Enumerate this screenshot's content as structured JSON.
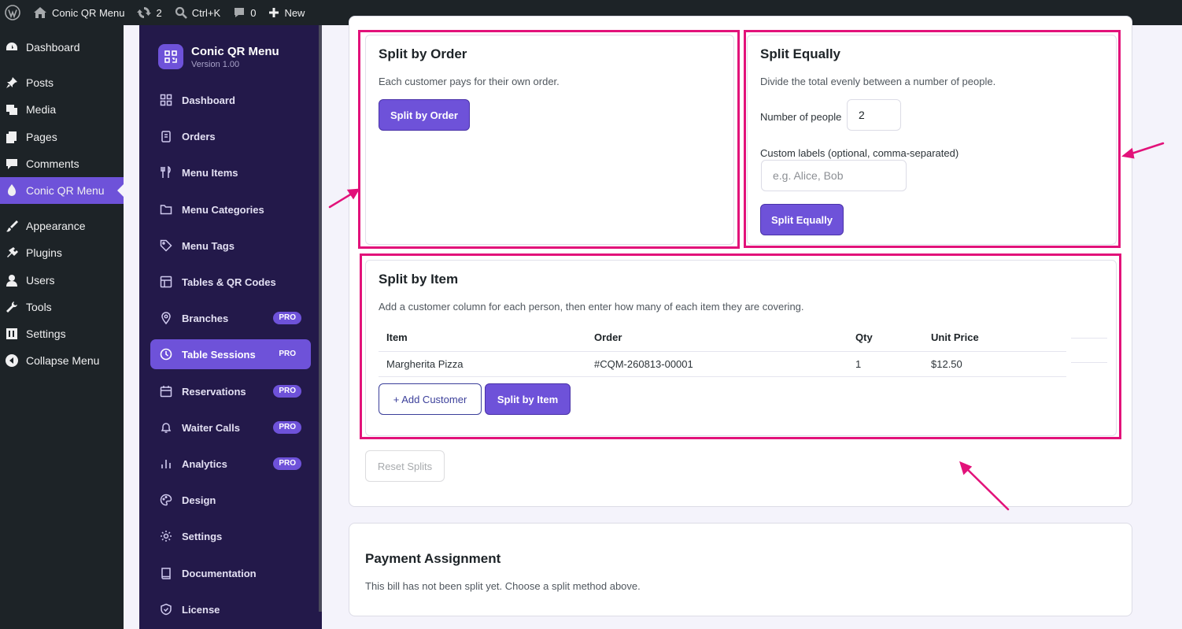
{
  "adminbar": {
    "site_name": "Conic QR Menu",
    "updates_count": "2",
    "search_shortcut": "Ctrl+K",
    "comments_count": "0",
    "new_label": "New"
  },
  "wp_menu": {
    "items": [
      {
        "label": "Dashboard",
        "icon": "dashboard-icon"
      },
      {
        "label": "Posts",
        "icon": "pin-icon"
      },
      {
        "label": "Media",
        "icon": "media-icon"
      },
      {
        "label": "Pages",
        "icon": "pages-icon"
      },
      {
        "label": "Comments",
        "icon": "comment-icon"
      },
      {
        "label": "Conic QR Menu",
        "icon": "plugin-icon"
      },
      {
        "label": "Appearance",
        "icon": "brush-icon"
      },
      {
        "label": "Plugins",
        "icon": "plug-icon"
      },
      {
        "label": "Users",
        "icon": "user-icon"
      },
      {
        "label": "Tools",
        "icon": "wrench-icon"
      },
      {
        "label": "Settings",
        "icon": "settings-icon"
      },
      {
        "label": "Collapse Menu",
        "icon": "collapse-icon"
      }
    ]
  },
  "plugin": {
    "name": "Conic QR Menu",
    "version": "Version 1.00",
    "pro_label": "PRO",
    "nav": [
      {
        "label": "Dashboard",
        "icon": "grid-icon"
      },
      {
        "label": "Orders",
        "icon": "clipboard-icon"
      },
      {
        "label": "Menu Items",
        "icon": "utensils-icon"
      },
      {
        "label": "Menu Categories",
        "icon": "folder-icon"
      },
      {
        "label": "Menu Tags",
        "icon": "tag-icon"
      },
      {
        "label": "Tables & QR Codes",
        "icon": "table-icon"
      },
      {
        "label": "Branches",
        "icon": "location-icon"
      },
      {
        "label": "Table Sessions",
        "icon": "clock-icon"
      },
      {
        "label": "Reservations",
        "icon": "calendar-icon"
      },
      {
        "label": "Waiter Calls",
        "icon": "bell-icon"
      },
      {
        "label": "Analytics",
        "icon": "bar-chart-icon"
      },
      {
        "label": "Design",
        "icon": "palette-icon"
      },
      {
        "label": "Settings",
        "icon": "gear-icon"
      },
      {
        "label": "Documentation",
        "icon": "book-icon"
      },
      {
        "label": "License",
        "icon": "shield-icon"
      }
    ]
  },
  "split_by_order": {
    "title": "Split by Order",
    "description": "Each customer pays for their own order.",
    "button": "Split by Order"
  },
  "split_equally": {
    "title": "Split Equally",
    "description": "Divide the total evenly between a number of people.",
    "people_label": "Number of people",
    "people_value": "2",
    "labels_label": "Custom labels (optional, comma-separated)",
    "labels_placeholder": "e.g. Alice, Bob",
    "button": "Split Equally"
  },
  "split_by_item": {
    "title": "Split by Item",
    "description": "Add a customer column for each person, then enter how many of each item they are covering.",
    "columns": [
      "Item",
      "Order",
      "Qty",
      "Unit Price"
    ],
    "rows": [
      [
        "Margherita Pizza",
        "#CQM-260813-00001",
        "1",
        "$12.50"
      ]
    ],
    "add_customer": "+ Add Customer",
    "button": "Split by Item"
  },
  "reset_splits": "Reset Splits",
  "payment_assignment": {
    "title": "Payment Assignment",
    "message": "This bill has not been split yet. Choose a split method above."
  },
  "colors": {
    "accent": "#6e52d9",
    "highlight": "#e2127a",
    "sidebar": "#23194a",
    "wp_menu": "#1d2327"
  }
}
